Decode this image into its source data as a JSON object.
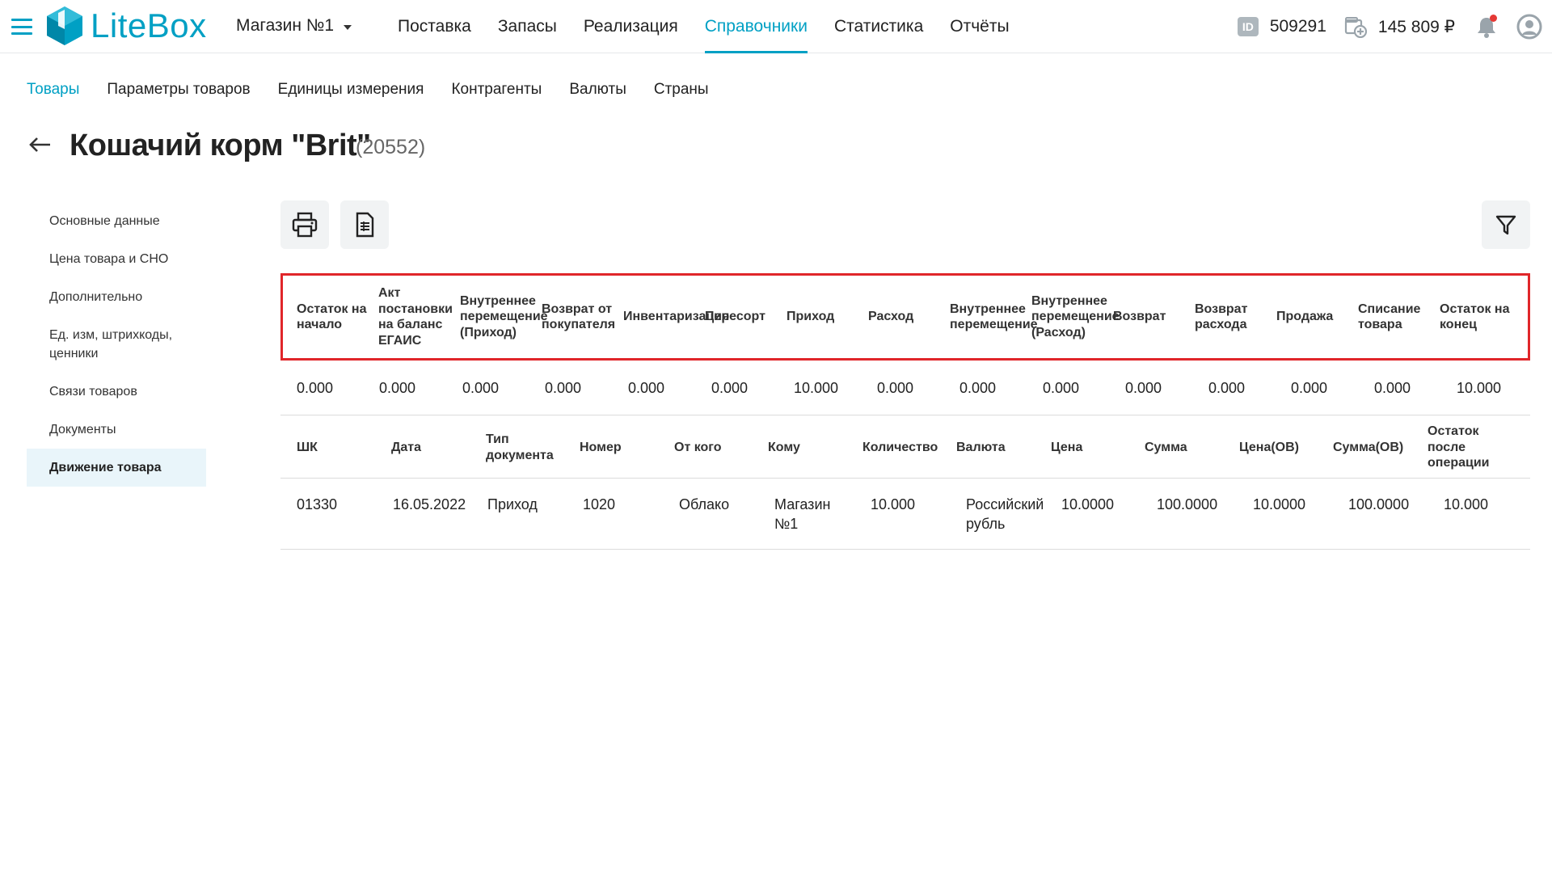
{
  "header": {
    "logo_text": "LiteBox",
    "store": "Магазин №1",
    "nav": [
      {
        "label": "Поставка"
      },
      {
        "label": "Запасы"
      },
      {
        "label": "Реализация"
      },
      {
        "label": "Справочники",
        "active": true
      },
      {
        "label": "Статистика"
      },
      {
        "label": "Отчёты"
      }
    ],
    "id_badge": "ID",
    "id_value": "509291",
    "balance": "145 809 ₽",
    "icons": {
      "menu": "hamburger-icon",
      "logo": "litebox-logo",
      "balance": "wallet-icon",
      "notifications": "bell-icon",
      "user": "user-avatar-icon"
    }
  },
  "subnav": [
    {
      "label": "Товары",
      "active": true
    },
    {
      "label": "Параметры товаров"
    },
    {
      "label": "Единицы измерения"
    },
    {
      "label": "Контрагенты"
    },
    {
      "label": "Валюты"
    },
    {
      "label": "Страны"
    }
  ],
  "page": {
    "title": "Кошачий корм \"Brit\"",
    "id": "(20552)"
  },
  "sidemenu": [
    {
      "label": "Основные данные"
    },
    {
      "label": "Цена товара и СНО"
    },
    {
      "label": "Дополнительно"
    },
    {
      "label": "Ед. изм, штрихкоды, ценники"
    },
    {
      "label": "Связи товаров"
    },
    {
      "label": "Документы"
    },
    {
      "label": "Движение товара",
      "active": true
    }
  ],
  "toolbar": {
    "print_icon": "printer-icon",
    "export_icon": "document-export-icon",
    "filter_icon": "filter-icon"
  },
  "summary": {
    "headers": [
      "Остаток на начало",
      "Акт постановки на баланс ЕГАИС",
      "Внутреннее перемещение (Приход)",
      "Возврат от покупателя",
      "Инвентаризация",
      "Пересорт",
      "Приход",
      "Расход",
      "Внутреннее перемещение",
      "Внутреннее перемещение (Расход)",
      "Возврат",
      "Возврат расхода",
      "Продажа",
      "Списание товара",
      "Остаток на конец"
    ],
    "values": [
      "0.000",
      "0.000",
      "0.000",
      "0.000",
      "0.000",
      "0.000",
      "10.000",
      "0.000",
      "0.000",
      "0.000",
      "0.000",
      "0.000",
      "0.000",
      "0.000",
      "10.000"
    ]
  },
  "movement": {
    "headers": [
      "ШК",
      "Дата",
      "Тип документа",
      "Номер",
      "От кого",
      "Кому",
      "Количество",
      "Валюта",
      "Цена",
      "Сумма",
      "Цена(ОВ)",
      "Сумма(ОВ)",
      "Остаток после операции"
    ],
    "rows": [
      [
        "01330",
        "16.05.2022",
        "Приход",
        "1020",
        "Облако",
        "Магазин №1",
        "10.000",
        "Российский рубль",
        "10.0000",
        "100.0000",
        "10.0000",
        "100.0000",
        "10.000"
      ]
    ]
  }
}
